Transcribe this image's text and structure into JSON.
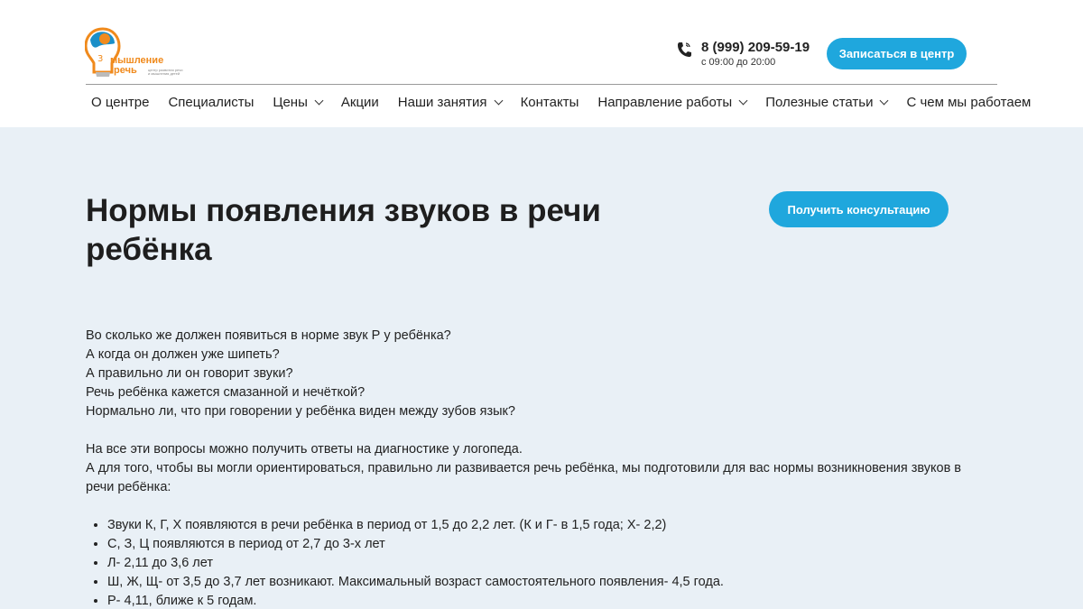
{
  "header": {
    "logo": {
      "line1": "мышление",
      "line2": "речь",
      "tagline": "центр развития речи и мышления детей"
    },
    "phone": {
      "number": "8 (999) 209-59-19",
      "hours": "с 09:00 до 20:00"
    },
    "signup_button": "Записаться в центр"
  },
  "nav": {
    "items": [
      {
        "label": "О центре",
        "has_dropdown": false
      },
      {
        "label": "Специалисты",
        "has_dropdown": false
      },
      {
        "label": "Цены",
        "has_dropdown": true
      },
      {
        "label": "Акции",
        "has_dropdown": false
      },
      {
        "label": "Наши занятия",
        "has_dropdown": true
      },
      {
        "label": "Контакты",
        "has_dropdown": false
      },
      {
        "label": "Направление работы",
        "has_dropdown": true
      },
      {
        "label": "Полезные статьи",
        "has_dropdown": true
      },
      {
        "label": "С чем мы работаем",
        "has_dropdown": false
      }
    ]
  },
  "page": {
    "title": "Нормы появления звуков в речи ребёнка",
    "consult_button": "Получить консультацию",
    "questions": [
      "Во сколько же должен появиться в норме звук Р у ребёнка?",
      "А когда он должен уже шипеть?",
      "А правильно ли он говорит звуки?",
      "Речь ребёнка кажется смазанной и нечёткой?",
      "Нормально ли, что при говорении у ребёнка виден между зубов язык?"
    ],
    "intro": [
      "На все эти вопросы можно получить ответы на диагностике у логопеда.",
      "А для того, чтобы вы могли ориентироваться, правильно ли развивается речь ребёнка, мы подготовили для вас нормы возникновения звуков в речи ребёнка:"
    ],
    "norms": [
      "Звуки К, Г, Х появляются в речи ребёнка в период от 1,5 до 2,2 лет. (К и Г- в 1,5 года; Х- 2,2)",
      "С, З, Ц появляются в период от 2,7 до 3-х лет",
      "Л- 2,11 до 3,6 лет",
      "Ш, Ж, Щ- от 3,5 до 3,7 лет возникают. Максимальный возраст самостоятельного появления- 4,5 года.",
      "Р- 4,11, ближе к 5 годам."
    ]
  },
  "colors": {
    "accent": "#1fa7dd",
    "page_bg": "#e9f0f6",
    "logo_orange": "#f08a1c"
  }
}
